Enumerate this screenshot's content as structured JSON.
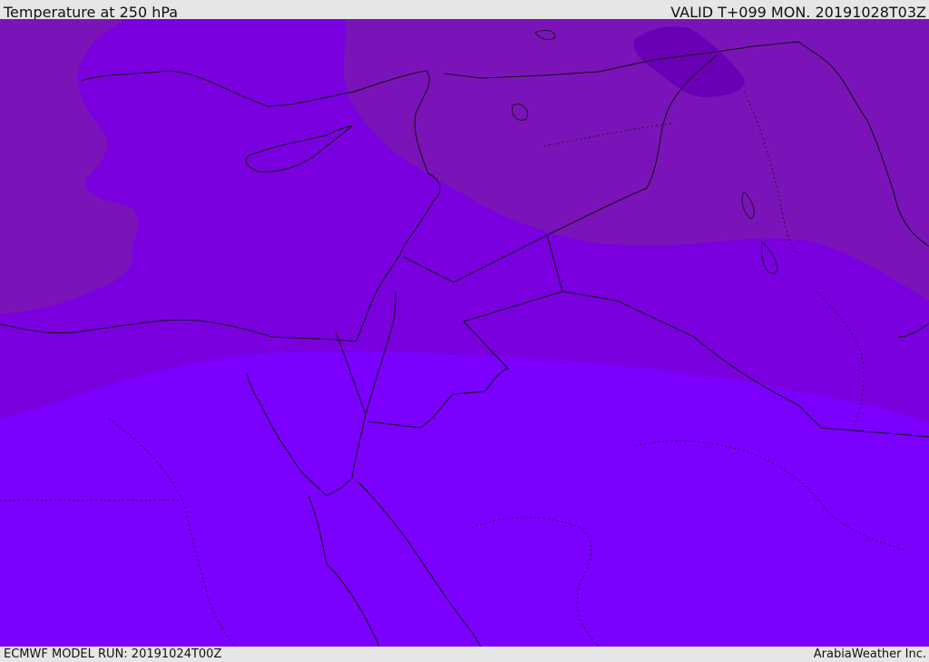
{
  "header": {
    "title": "Temperature at 250 hPa",
    "valid": "VALID T+099 MON. 20191028T03Z"
  },
  "footer": {
    "model_run": "ECMWF MODEL RUN: 20191024T00Z",
    "credit": "ArabiaWeather Inc."
  },
  "colors": {
    "band_coldest": "#6a00b5",
    "band_cold": "#7a14b8",
    "band_mid": "#7a00e0",
    "band_warm": "#7b00ff",
    "boundary_line": "#111111",
    "header_bg": "#e6e6e6"
  }
}
